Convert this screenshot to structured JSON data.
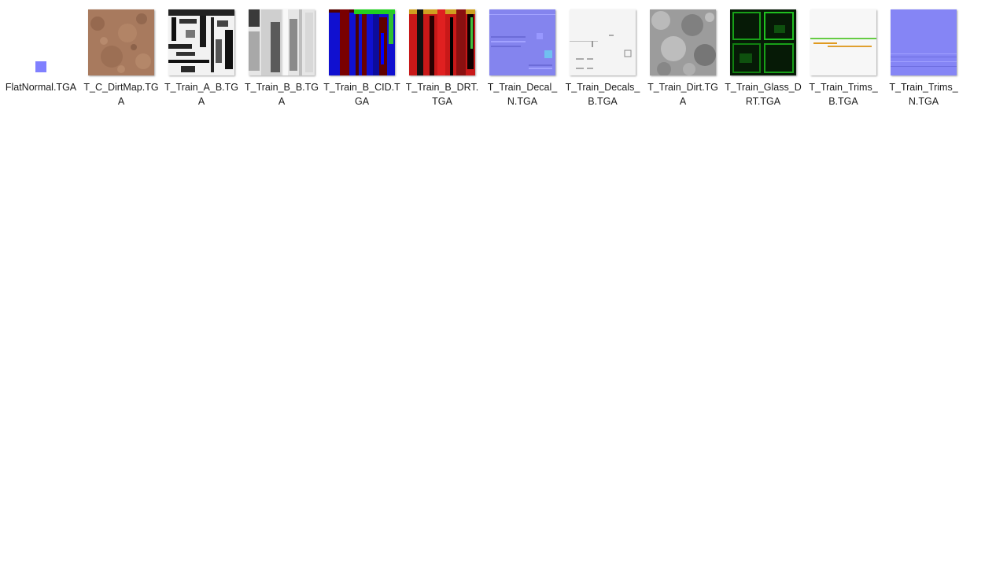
{
  "folder": {
    "files": [
      {
        "name": "FlatNormal.TGA",
        "thumb": "flat-normal-swatch",
        "color": "#8080ff"
      },
      {
        "name": "T_C_DirtMap.TGA",
        "thumb": "dirt-map-texture",
        "color": "#a0735a"
      },
      {
        "name": "T_Train_A_B.TGA",
        "thumb": "grayscale-panel-texture",
        "color": "#f0f0f0"
      },
      {
        "name": "T_Train_B_B.TGA",
        "thumb": "grayscale-gradient-texture",
        "color": "#cfcfcf"
      },
      {
        "name": "T_Train_B_CID.TGA",
        "thumb": "color-id-texture",
        "color": "#1010c8"
      },
      {
        "name": "T_Train_B_DRT.TGA",
        "thumb": "red-dirt-texture",
        "color": "#b01010"
      },
      {
        "name": "T_Train_Decal_N.TGA",
        "thumb": "decal-normal-texture",
        "color": "#8888f0"
      },
      {
        "name": "T_Train_Decals_B.TGA",
        "thumb": "decals-base-texture",
        "color": "#f2f2f2"
      },
      {
        "name": "T_Train_Dirt.TGA",
        "thumb": "grunge-texture",
        "color": "#9a9a9a"
      },
      {
        "name": "T_Train_Glass_DRT.TGA",
        "thumb": "glass-dirt-texture",
        "color": "#0a3a0a"
      },
      {
        "name": "T_Train_Trims_B.TGA",
        "thumb": "trims-base-texture",
        "color": "#f7f7f7"
      },
      {
        "name": "T_Train_Trims_N.TGA",
        "thumb": "trims-normal-texture",
        "color": "#8585f5"
      }
    ]
  }
}
